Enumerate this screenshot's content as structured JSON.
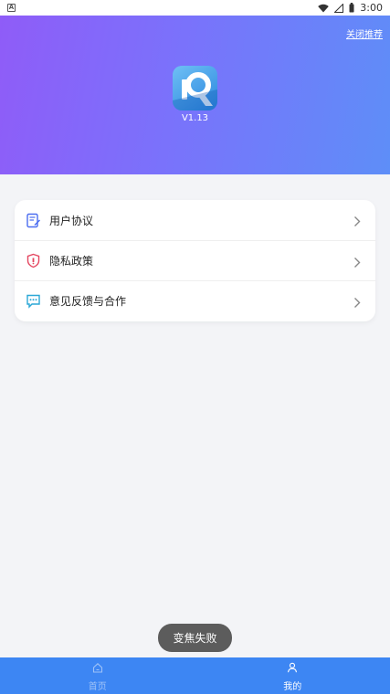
{
  "status_bar": {
    "notification_glyph": "A",
    "time": "3:00",
    "icons": [
      "wifi-icon",
      "signal-icon",
      "battery-icon"
    ]
  },
  "header": {
    "close_recommend": "关闭推荐",
    "version": "V1.13",
    "logo_icon": "app-logo-icon",
    "gradient": [
      "#8f5cf8",
      "#5e8ef8"
    ]
  },
  "menu": {
    "items": [
      {
        "label": "用户协议",
        "icon": "document-icon",
        "icon_color": "#4a6cf0"
      },
      {
        "label": "隐私政策",
        "icon": "shield-icon",
        "icon_color": "#e4455f"
      },
      {
        "label": "意见反馈与合作",
        "icon": "chat-bubble-icon",
        "icon_color": "#2aa7d6"
      }
    ]
  },
  "toast": {
    "text": "变焦失败"
  },
  "bottom_nav": {
    "background": "#3d86f3",
    "tabs": [
      {
        "label": "首页",
        "icon": "home-icon",
        "active": false
      },
      {
        "label": "我的",
        "icon": "user-icon",
        "active": true
      }
    ]
  }
}
